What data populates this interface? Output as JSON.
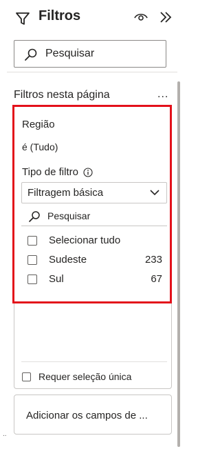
{
  "header": {
    "title": "Filtros",
    "icons": [
      "funnel-icon",
      "eye-icon",
      "double-chevron-right-icon"
    ]
  },
  "search": {
    "placeholder": "Pesquisar"
  },
  "section": {
    "title": "Filtros nesta página",
    "more_label": "..."
  },
  "filter_card": {
    "field_name": "Região",
    "field_value": "é (Tudo)",
    "filter_type_label": "Tipo de filtro",
    "filter_type_value": "Filtragem básica",
    "search_placeholder": "Pesquisar",
    "options": [
      {
        "label": "Selecionar tudo",
        "count": "",
        "checked": false
      },
      {
        "label": "Sudeste",
        "count": "233",
        "checked": false
      },
      {
        "label": "Sul",
        "count": "67",
        "checked": false
      }
    ],
    "require_single_label": "Requer seleção única"
  },
  "add_field": {
    "label": "Adicionar os campos de ..."
  },
  "colors": {
    "highlight": "#e3101a",
    "text": "#252423",
    "border": "#c8c6c4"
  }
}
